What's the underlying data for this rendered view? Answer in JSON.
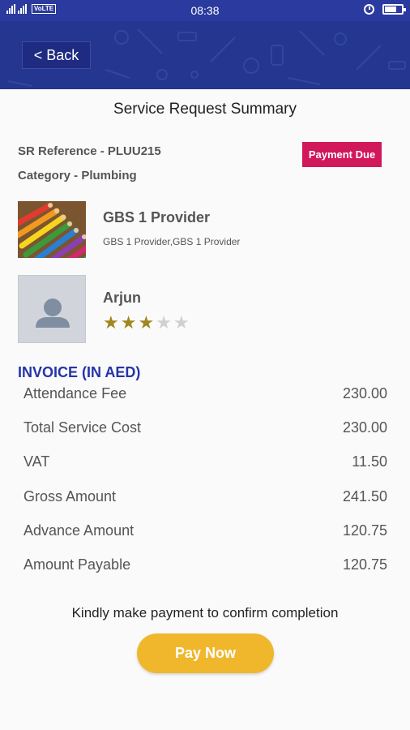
{
  "status_bar": {
    "volte": "VoLTE",
    "time": "08:38"
  },
  "header": {
    "back_label": "< Back"
  },
  "page_title": "Service Request Summary",
  "request": {
    "sr_reference": "SR Reference - PLUU215",
    "category": "Category - Plumbing",
    "status_badge": "Payment Due"
  },
  "provider": {
    "name": "GBS 1 Provider",
    "subtitle": "GBS 1 Provider,GBS 1 Provider"
  },
  "technician": {
    "name": "Arjun",
    "rating": 3,
    "rating_max": 5
  },
  "invoice": {
    "title": "INVOICE (IN AED)",
    "rows": [
      {
        "label": "Attendance Fee",
        "value": "230.00"
      },
      {
        "label": "Total Service Cost",
        "value": "230.00"
      },
      {
        "label": "VAT",
        "value": "11.50"
      },
      {
        "label": "Gross Amount",
        "value": "241.50"
      },
      {
        "label": "Advance Amount",
        "value": "120.75"
      },
      {
        "label": "Amount Payable",
        "value": "120.75"
      }
    ]
  },
  "footer": {
    "note": "Kindly make payment to confirm completion",
    "pay_label": "Pay Now"
  },
  "colors": {
    "header": "#24368f",
    "badge": "#d1185a",
    "invoice_title": "#2534a8",
    "pay_button": "#f0b72c",
    "star_on": "#a08720"
  }
}
